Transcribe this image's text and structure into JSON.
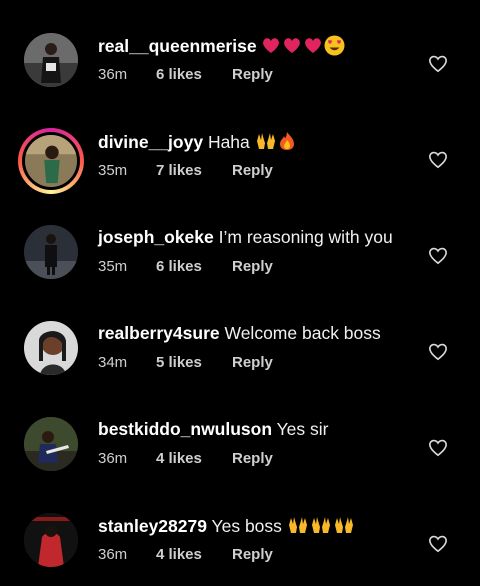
{
  "comments": [
    {
      "username": "real__queenmerise",
      "text": "",
      "emojis": [
        "heart-red-icon",
        "heart-red-icon",
        "heart-red-icon",
        "heart-eyes-icon"
      ],
      "time": "36m",
      "likes": "6 likes",
      "reply": "Reply",
      "story": false
    },
    {
      "username": "divine__joyy",
      "text": "Haha",
      "emojis": [
        "raised-hands-icon",
        "fire-icon"
      ],
      "time": "35m",
      "likes": "7 likes",
      "reply": "Reply",
      "story": true
    },
    {
      "username": "joseph_okeke",
      "text": "I’m reasoning with you",
      "emojis": [],
      "time": "35m",
      "likes": "6 likes",
      "reply": "Reply",
      "story": false
    },
    {
      "username": "realberry4sure",
      "text": "Welcome back boss",
      "emojis": [],
      "time": "34m",
      "likes": "5 likes",
      "reply": "Reply",
      "story": false
    },
    {
      "username": "bestkiddo_nwuluson",
      "text": "Yes sir",
      "emojis": [],
      "time": "36m",
      "likes": "4 likes",
      "reply": "Reply",
      "story": false
    },
    {
      "username": "stanley28279",
      "text": "Yes boss",
      "emojis": [
        "raised-hands-icon",
        "raised-hands-icon",
        "raised-hands-icon"
      ],
      "time": "36m",
      "likes": "4 likes",
      "reply": "Reply",
      "story": false
    }
  ],
  "colors": {
    "background": "#000000",
    "heart_red": "#e0245e",
    "muted_text": "#cfcfcf"
  }
}
